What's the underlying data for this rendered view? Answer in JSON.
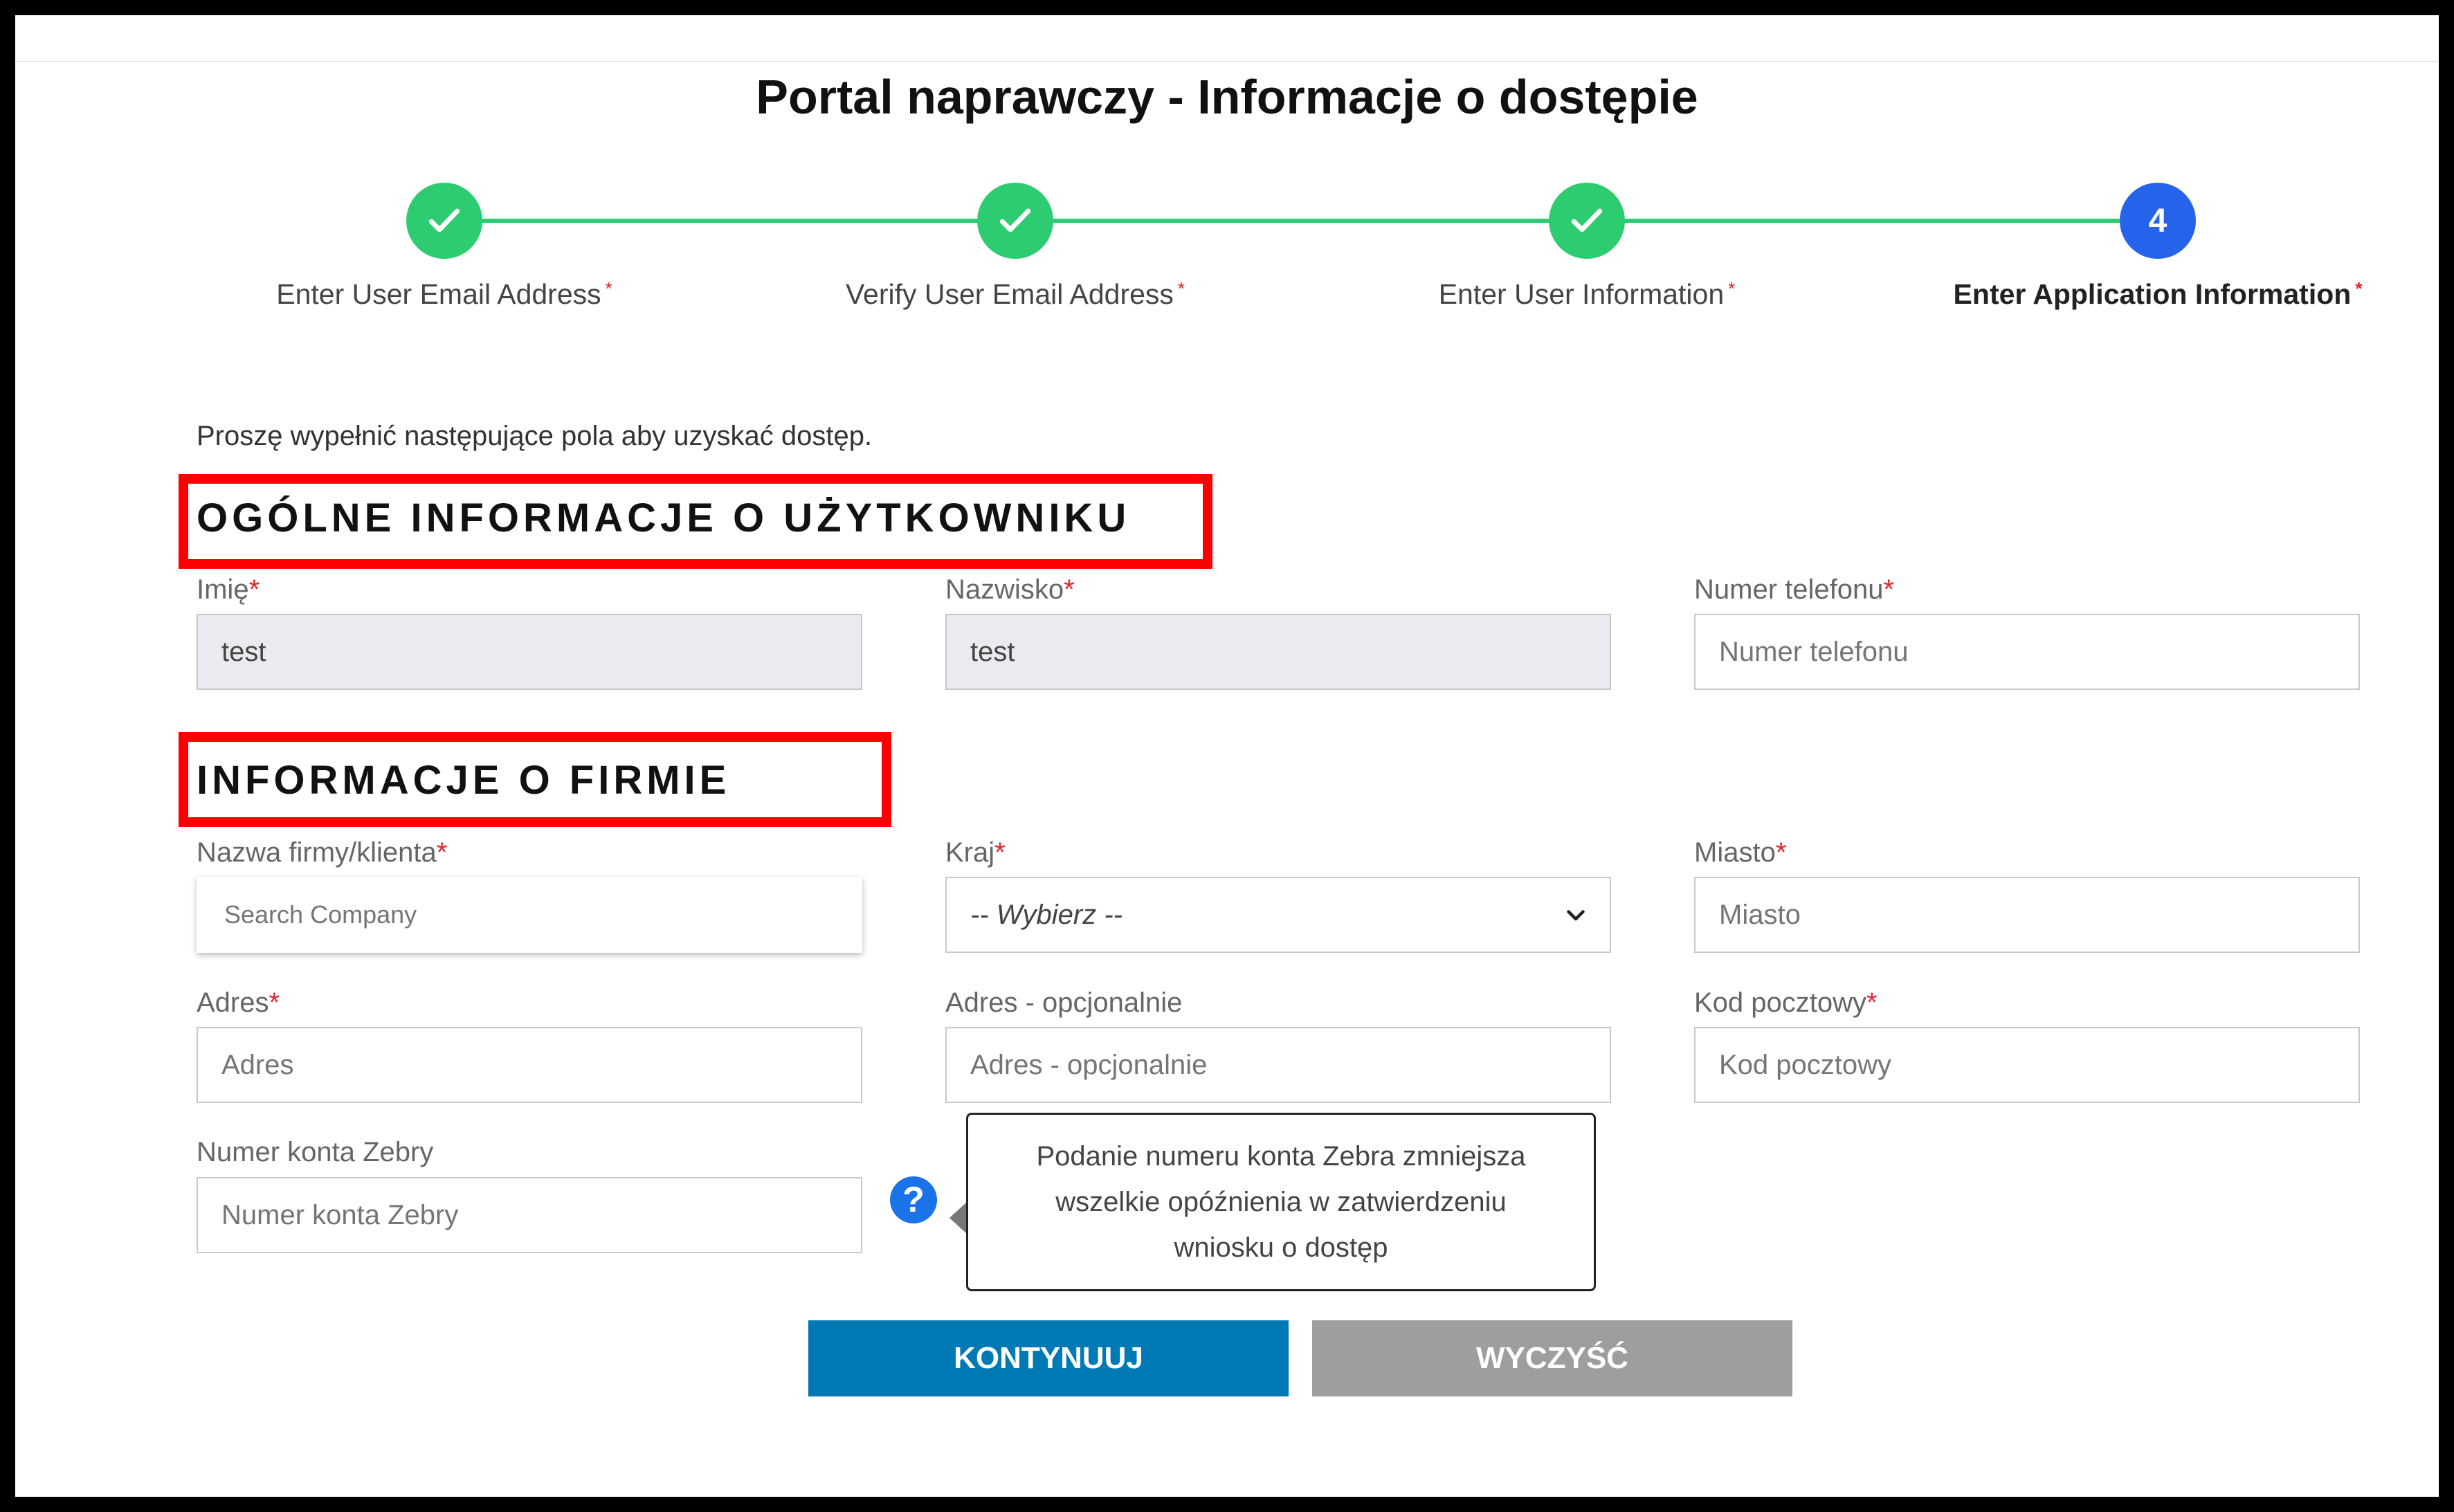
{
  "page": {
    "title": "Portal naprawczy - Informacje o dostępie",
    "intro": "Proszę wypełnić następujące pola aby uzyskać dostęp."
  },
  "colors": {
    "step_done": "#2ecc71",
    "step_active": "#2563eb",
    "primary_button": "#0079b4",
    "secondary_button": "#9e9e9e",
    "highlight_box": "#ff0000",
    "required_marker": "#e3262e"
  },
  "steps": [
    {
      "label": "Enter User Email Address",
      "status": "done",
      "icon": "check-icon"
    },
    {
      "label": "Verify User Email Address",
      "status": "done",
      "icon": "check-icon"
    },
    {
      "label": "Enter User Information",
      "status": "done",
      "icon": "check-icon"
    },
    {
      "label": "Enter Application Information",
      "status": "active",
      "number": "4"
    }
  ],
  "required_marker": "*",
  "sections": {
    "user": {
      "title": "OGÓLNE INFORMACJE O UŻYTKOWNIKU"
    },
    "company": {
      "title": "INFORMACJE O FIRMIE"
    }
  },
  "fields": {
    "first_name": {
      "label": "Imię",
      "value": "test"
    },
    "last_name": {
      "label": "Nazwisko",
      "value": "test"
    },
    "phone": {
      "label": "Numer telefonu",
      "placeholder": "Numer telefonu"
    },
    "company": {
      "label": "Nazwa firmy/klienta",
      "placeholder": "Search Company"
    },
    "country": {
      "label": "Kraj",
      "selected": "-- Wybierz --"
    },
    "city": {
      "label": "Miasto",
      "placeholder": "Miasto"
    },
    "address": {
      "label": "Adres",
      "placeholder": "Adres"
    },
    "address_optional": {
      "label": "Adres - opcjonalnie",
      "placeholder": "Adres - opcjonalnie"
    },
    "postal_code": {
      "label": "Kod pocztowy",
      "placeholder": "Kod pocztowy"
    },
    "zebra_account": {
      "label": "Numer konta Zebry",
      "placeholder": "Numer konta Zebry"
    }
  },
  "help": {
    "icon": "question-icon",
    "glyph": "?",
    "tooltip_lines": [
      "Podanie numeru konta Zebra zmniejsza",
      "wszelkie opóźnienia w zatwierdzeniu",
      "wniosku o dostęp"
    ]
  },
  "buttons": {
    "continue": "KONTYNUUJ",
    "clear": "WYCZYŚĆ"
  }
}
